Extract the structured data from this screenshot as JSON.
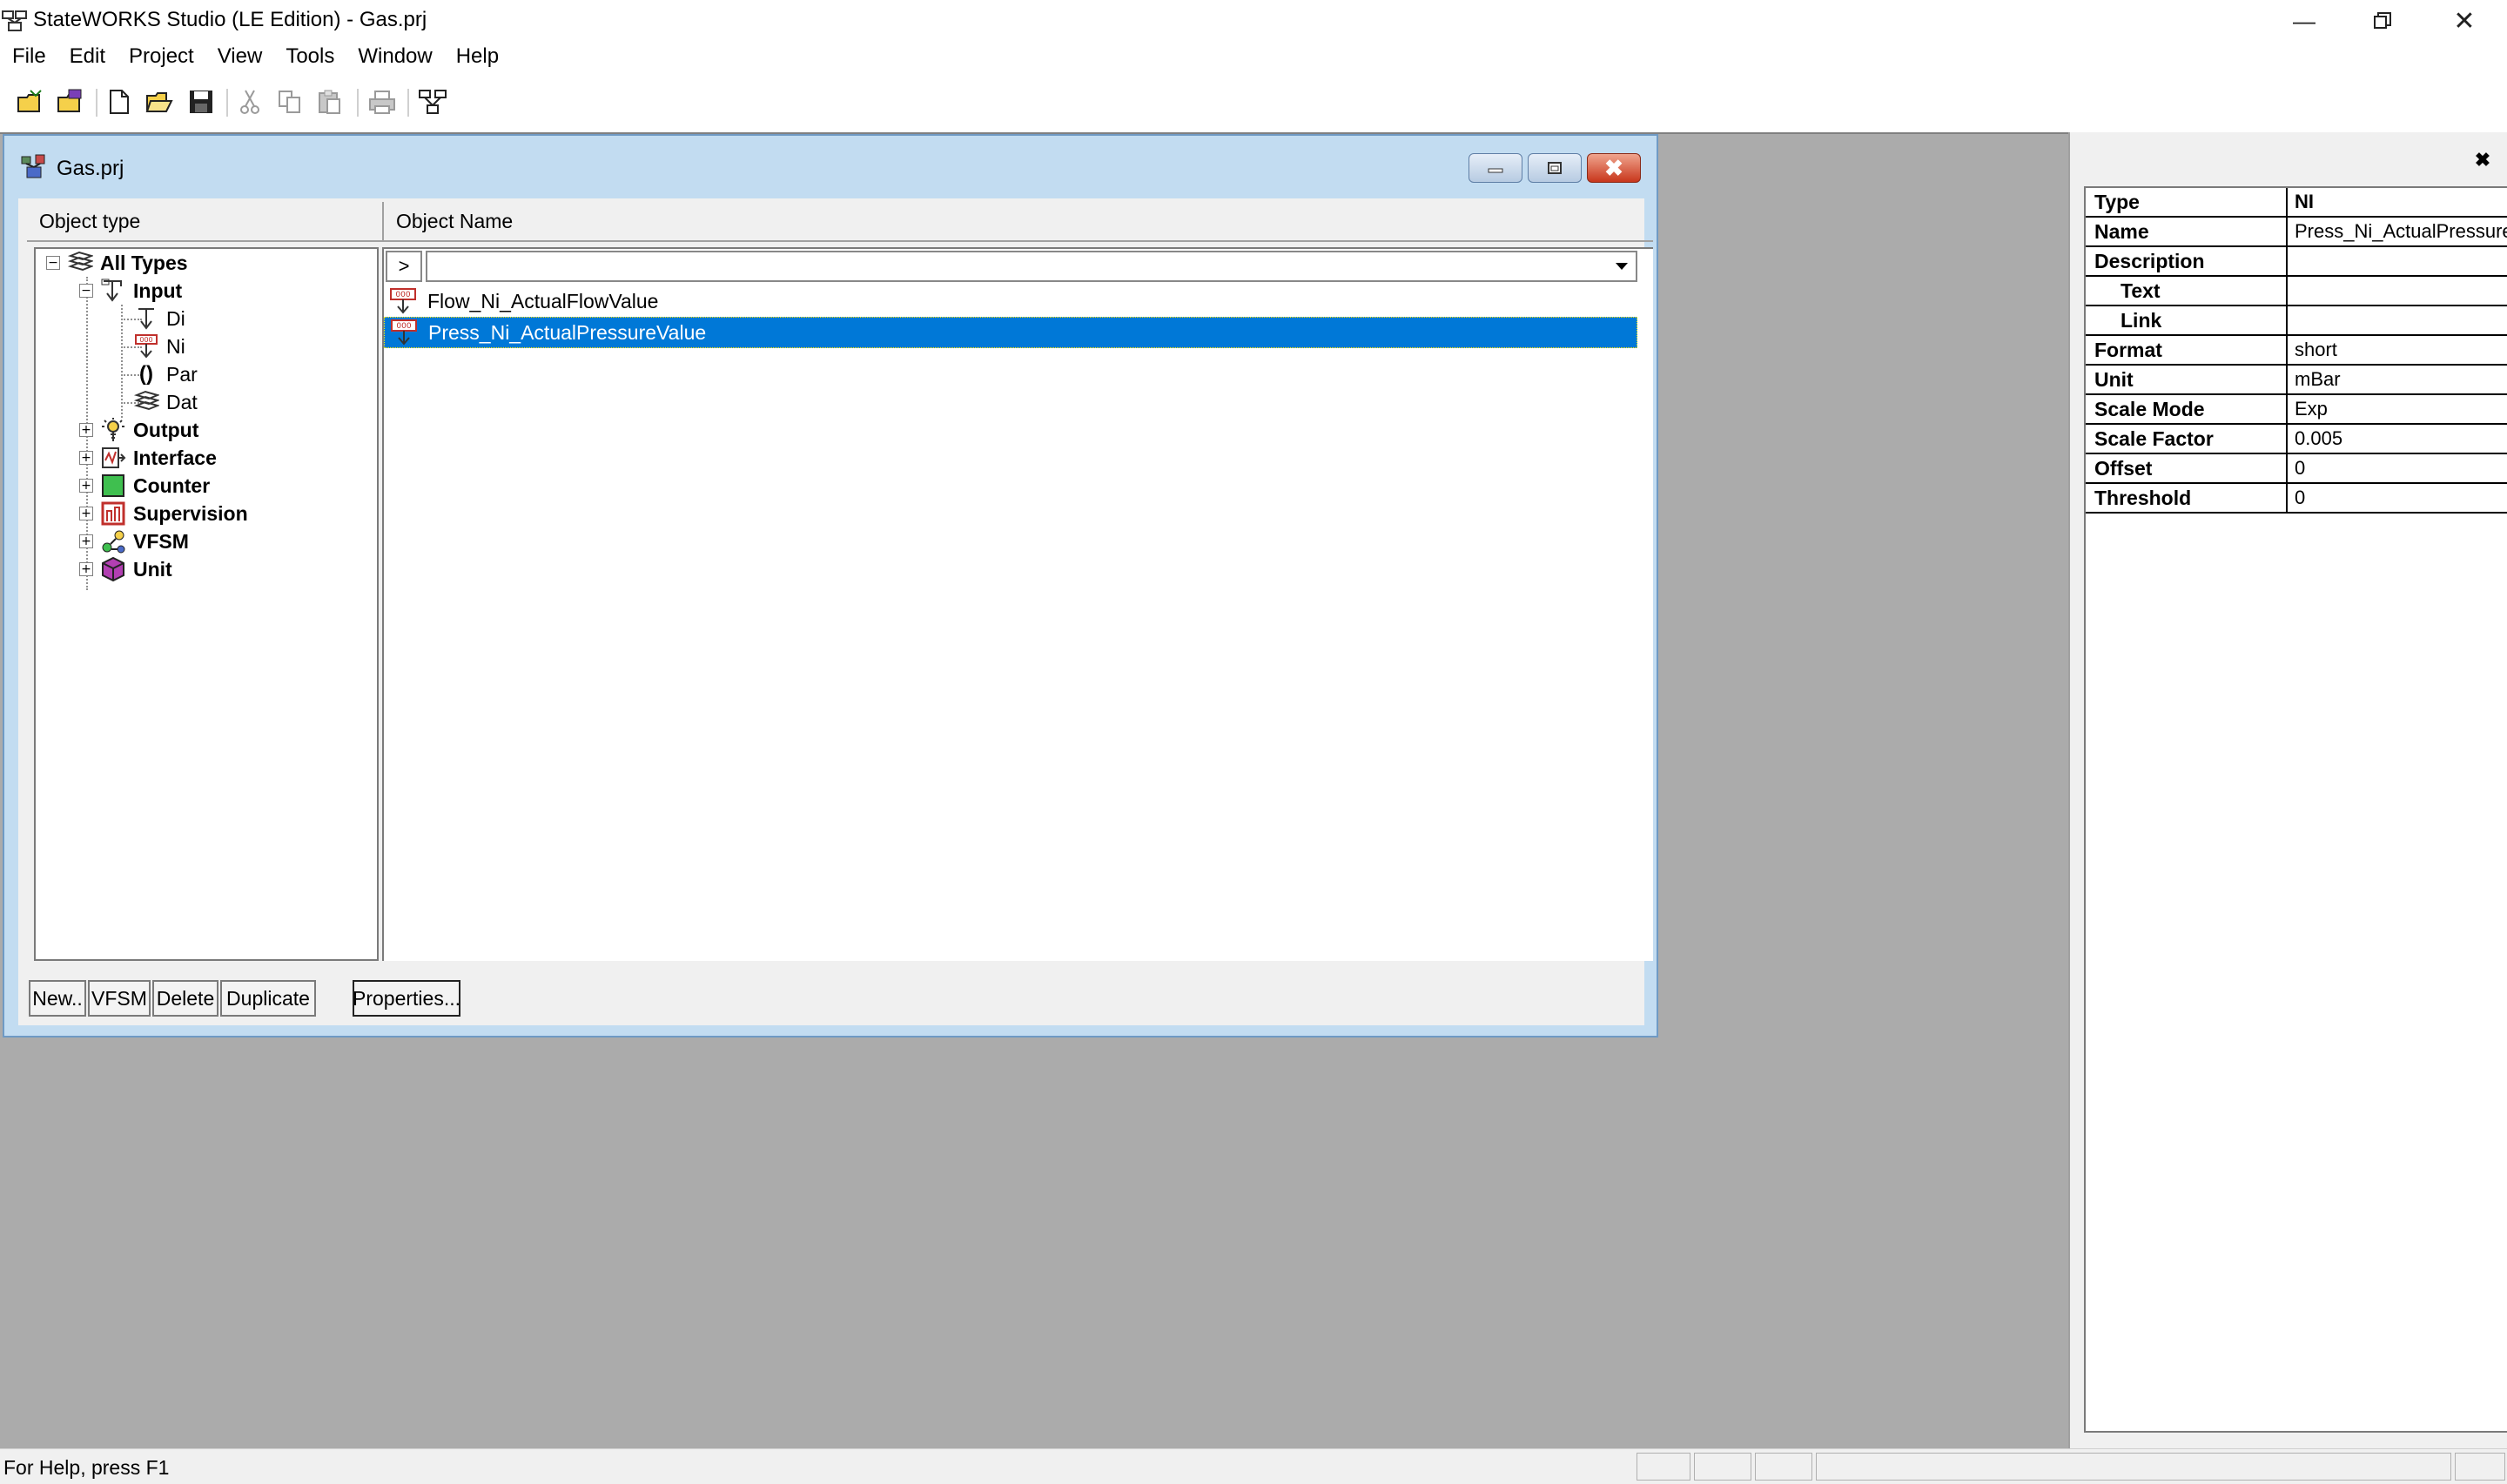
{
  "app": {
    "title": "StateWORKS Studio (LE Edition) - Gas.prj"
  },
  "menu": [
    "File",
    "Edit",
    "Project",
    "View",
    "Tools",
    "Window",
    "Help"
  ],
  "child": {
    "title": "Gas.prj",
    "object_type_header": "Object type",
    "object_name_header": "Object Name",
    "filter_arrow": ">",
    "filter_value": "",
    "tree": {
      "all_types": "All Types",
      "input": "Input",
      "di": "Di",
      "ni": "Ni",
      "par": "Par",
      "dat": "Dat",
      "output": "Output",
      "interface": "Interface",
      "counter": "Counter",
      "supervision": "Supervision",
      "vfsm": "VFSM",
      "unit": "Unit"
    },
    "objects": [
      "Flow_Ni_ActualFlowValue",
      "Press_Ni_ActualPressureValue"
    ],
    "selected_index": 1,
    "buttons": {
      "new": "New..",
      "vfsm": "VFSM",
      "delete": "Delete",
      "duplicate": "Duplicate",
      "properties": "Properties..."
    }
  },
  "properties": {
    "type_label": "Type",
    "type_value": "NI",
    "name_label": "Name",
    "name_value": "Press_Ni_ActualPressureValue",
    "description_label": "Description",
    "description_value": "",
    "text_label": "Text",
    "text_value": "",
    "link_label": "Link",
    "link_value": "",
    "format_label": "Format",
    "format_value": "short",
    "unit_label": "Unit",
    "unit_value": "mBar",
    "scale_mode_label": "Scale Mode",
    "scale_mode_value": "Exp",
    "scale_factor_label": "Scale Factor",
    "scale_factor_value": "0.005",
    "offset_label": "Offset",
    "offset_value": "0",
    "threshold_label": "Threshold",
    "threshold_value": "0"
  },
  "status": {
    "text": "For Help, press F1"
  },
  "colors": {
    "selection": "#0078d7",
    "mdi_background": "#ababab",
    "child_frame": "#c2dcf1"
  }
}
